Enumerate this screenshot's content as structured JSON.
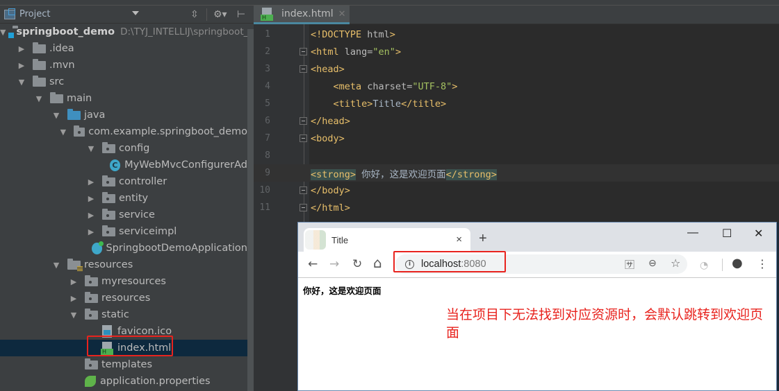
{
  "project_panel": {
    "header_label": "Project",
    "toolbar_icons": [
      "collapse-icon",
      "gear-icon",
      "hide-icon"
    ],
    "tree": [
      {
        "label": "springboot_demo",
        "path": "D:\\TYJ_INTELLIJ\\springboot_d",
        "type": "project",
        "expanded": true,
        "level": 0
      },
      {
        "label": ".idea",
        "type": "folder",
        "expanded": false,
        "level": 1
      },
      {
        "label": ".mvn",
        "type": "folder",
        "expanded": false,
        "level": 1
      },
      {
        "label": "src",
        "type": "folder",
        "expanded": true,
        "level": 1
      },
      {
        "label": "main",
        "type": "folder",
        "expanded": true,
        "level": 2
      },
      {
        "label": "java",
        "type": "source-folder",
        "expanded": true,
        "level": 3
      },
      {
        "label": "com.example.springboot_demo",
        "type": "package",
        "expanded": true,
        "level": 4
      },
      {
        "label": "config",
        "type": "package",
        "expanded": true,
        "level": 5
      },
      {
        "label": "MyWebMvcConfigurerAd",
        "type": "class",
        "level": 6
      },
      {
        "label": "controller",
        "type": "package",
        "expanded": false,
        "level": 5
      },
      {
        "label": "entity",
        "type": "package",
        "expanded": false,
        "level": 5
      },
      {
        "label": "service",
        "type": "package",
        "expanded": false,
        "level": 5
      },
      {
        "label": "serviceimpl",
        "type": "package",
        "expanded": false,
        "level": 5
      },
      {
        "label": "SpringbootDemoApplication",
        "type": "spring-app",
        "level": 5
      },
      {
        "label": "resources",
        "type": "resources-folder",
        "expanded": true,
        "level": 3
      },
      {
        "label": "myresources",
        "type": "package",
        "expanded": false,
        "level": 4
      },
      {
        "label": "resources",
        "type": "package",
        "expanded": false,
        "level": 4
      },
      {
        "label": "static",
        "type": "package",
        "expanded": true,
        "level": 4
      },
      {
        "label": "favicon.ico",
        "type": "ico-file",
        "level": 5
      },
      {
        "label": "index.html",
        "type": "html-file",
        "level": 5,
        "selected": true
      },
      {
        "label": "templates",
        "type": "package",
        "level": 4
      },
      {
        "label": "application.properties",
        "type": "properties-file",
        "level": 4
      }
    ]
  },
  "editor": {
    "tab_label": "index.html",
    "lines": [
      {
        "n": "1",
        "parts": [
          [
            "t",
            "<!DOCTYPE "
          ],
          [
            "a",
            "html"
          ],
          [
            "t",
            ">"
          ]
        ]
      },
      {
        "n": "2",
        "parts": [
          [
            "t",
            "<html "
          ],
          [
            "a",
            "lang="
          ],
          [
            "s",
            "\"en\""
          ],
          [
            "t",
            ">"
          ]
        ]
      },
      {
        "n": "3",
        "parts": [
          [
            "t",
            "<head>"
          ]
        ]
      },
      {
        "n": "4",
        "parts": [
          [
            "p",
            "    "
          ],
          [
            "t",
            "<meta "
          ],
          [
            "a",
            "charset="
          ],
          [
            "s",
            "\"UTF-8\""
          ],
          [
            "t",
            ">"
          ]
        ]
      },
      {
        "n": "5",
        "parts": [
          [
            "p",
            "    "
          ],
          [
            "t",
            "<title>"
          ],
          [
            "p",
            "Title"
          ],
          [
            "t",
            "</title>"
          ]
        ]
      },
      {
        "n": "6",
        "parts": [
          [
            "t",
            "</head>"
          ]
        ]
      },
      {
        "n": "7",
        "parts": [
          [
            "t",
            "<body>"
          ]
        ]
      },
      {
        "n": "8",
        "parts": []
      },
      {
        "n": "9",
        "parts": [
          [
            "h",
            "<strong>"
          ],
          [
            "p",
            " 你好，这是欢迎页面"
          ],
          [
            "h",
            "</strong>"
          ]
        ]
      },
      {
        "n": "10",
        "parts": [
          [
            "t",
            "</body>"
          ]
        ]
      },
      {
        "n": "11",
        "parts": [
          [
            "t",
            "</html>"
          ]
        ]
      }
    ]
  },
  "browser": {
    "tab_title": "Title",
    "tab_close": "×",
    "new_tab": "+",
    "window_controls": {
      "minimize": "—",
      "maximize": "☐",
      "close": "✕"
    },
    "nav": {
      "back": "←",
      "forward": "→",
      "reload": "↻",
      "home": "⌂"
    },
    "url_host": "localhost",
    "url_port": ":8080",
    "omnibox_icons": [
      "translate-icon",
      "zoom-out-icon",
      "star-icon"
    ],
    "page_text": "你好，这是欢迎页面"
  },
  "annotation": {
    "text": "当在项目下无法找到对应资源时，会默认跳转到欢迎页面",
    "color": "#e8231e"
  }
}
